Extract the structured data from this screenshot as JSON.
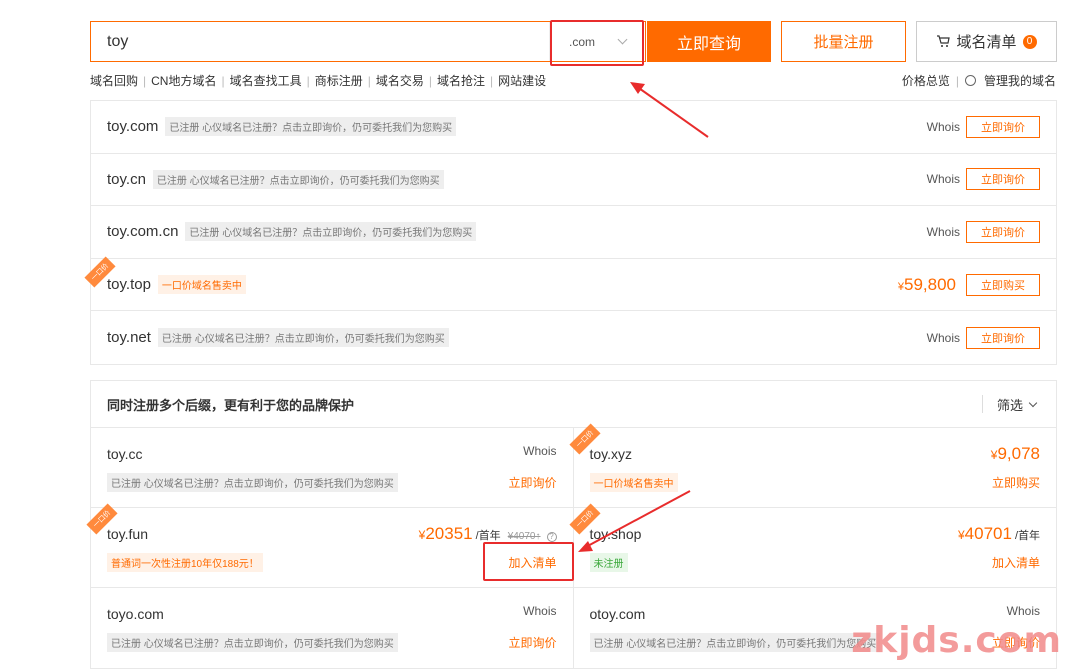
{
  "search": {
    "value": "toy",
    "suffix": ".com"
  },
  "buttons": {
    "query": "立即查询",
    "batch": "批量注册",
    "cart": "域名清单",
    "cart_count": "0"
  },
  "nav": {
    "links": [
      "域名回购",
      "CN地方域名",
      "域名查找工具",
      "商标注册",
      "域名交易",
      "域名抢注",
      "网站建设"
    ],
    "right": [
      "价格总览",
      "管理我的域名"
    ]
  },
  "results": [
    {
      "domain": "toy.com",
      "tag": "已注册 心仪域名已注册？点击立即询价，仍可委托我们为您购买",
      "whois": "Whois",
      "action": "立即询价"
    },
    {
      "domain": "toy.cn",
      "tag": "已注册 心仪域名已注册？点击立即询价，仍可委托我们为您购买",
      "whois": "Whois",
      "action": "立即询价"
    },
    {
      "domain": "toy.com.cn",
      "tag": "已注册 心仪域名已注册？点击立即询价，仍可委托我们为您购买",
      "whois": "Whois",
      "action": "立即询价"
    },
    {
      "domain": "toy.top",
      "tag": "一口价域名售卖中",
      "currency": "¥",
      "price": "59,800",
      "action": "立即购买",
      "ribbon": "一口价"
    },
    {
      "domain": "toy.net",
      "tag": "已注册 心仪域名已注册？点击立即询价，仍可委托我们为您购买",
      "whois": "Whois",
      "action": "立即询价"
    }
  ],
  "suggest": {
    "title": "同时注册多个后缀，更有利于您的品牌保护",
    "filter": "筛选",
    "items": [
      {
        "domain": "toy.cc",
        "tag": "已注册 心仪域名已注册？点击立即询价，仍可委托我们为您购买",
        "whois": "Whois",
        "action": "立即询价"
      },
      {
        "domain": "toy.xyz",
        "tag": "一口价域名售卖中",
        "currency": "¥",
        "price": "9,078",
        "action": "立即购买",
        "ribbon": "一口价"
      },
      {
        "domain": "toy.fun",
        "tag": "普通词一次性注册10年仅188元！",
        "currency": "¥",
        "price": "20351",
        "unit": "/首年",
        "old": "¥4070↑",
        "action": "加入清单",
        "ribbon": "一口价"
      },
      {
        "domain": "toy.shop",
        "tag": "未注册",
        "currency": "¥",
        "price": "40701",
        "unit": "/首年",
        "action": "加入清单",
        "ribbon": "一口价"
      },
      {
        "domain": "toyo.com",
        "tag": "已注册 心仪域名已注册？点击立即询价，仍可委托我们为您购买",
        "whois": "Whois",
        "action": "立即询价"
      },
      {
        "domain": "otoy.com",
        "tag": "已注册 心仪域名已注册？点击立即询价，仍可委托我们为您购买",
        "whois": "Whois",
        "action": "立即询价"
      }
    ]
  },
  "watermark": "zkjds.com",
  "colors": {
    "accent": "#ff6a00",
    "annotation": "#e82c2c"
  }
}
